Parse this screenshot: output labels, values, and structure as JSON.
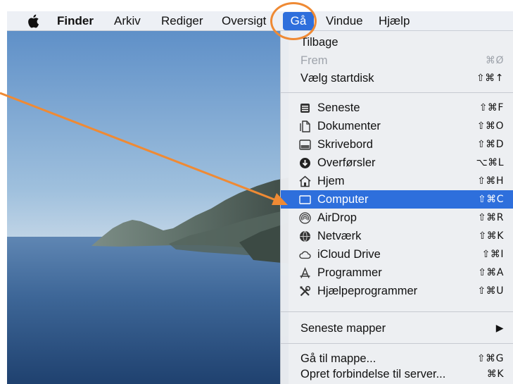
{
  "menubar": {
    "finder": "Finder",
    "arkiv": "Arkiv",
    "rediger": "Rediger",
    "oversigt": "Oversigt",
    "ga": "Gå",
    "vindue": "Vindue",
    "hjaelp": "Hjælp"
  },
  "menu": {
    "tilbage": {
      "label": "Tilbage"
    },
    "frem": {
      "label": "Frem",
      "shortcut": "⌘Ø"
    },
    "startdisk": {
      "label": "Vælg startdisk",
      "shortcut": "⇧⌘↑"
    },
    "seneste": {
      "label": "Seneste",
      "shortcut": "⇧⌘F",
      "icon": "recents-icon"
    },
    "dokumenter": {
      "label": "Dokumenter",
      "shortcut": "⇧⌘O",
      "icon": "documents-icon"
    },
    "skrivebord": {
      "label": "Skrivebord",
      "shortcut": "⇧⌘D",
      "icon": "desktop-icon"
    },
    "overforsler": {
      "label": "Overførsler",
      "shortcut": "⌥⌘L",
      "icon": "downloads-icon"
    },
    "hjem": {
      "label": "Hjem",
      "shortcut": "⇧⌘H",
      "icon": "home-icon"
    },
    "computer": {
      "label": "Computer",
      "shortcut": "⇧⌘C",
      "icon": "computer-icon"
    },
    "airdrop": {
      "label": "AirDrop",
      "shortcut": "⇧⌘R",
      "icon": "airdrop-icon"
    },
    "netvaerk": {
      "label": "Netværk",
      "shortcut": "⇧⌘K",
      "icon": "network-icon"
    },
    "icloud": {
      "label": "iCloud Drive",
      "shortcut": "⇧⌘I",
      "icon": "cloud-icon"
    },
    "programmer": {
      "label": "Programmer",
      "shortcut": "⇧⌘A",
      "icon": "applications-icon"
    },
    "hjaelpeprogrammer": {
      "label": "Hjælpeprogrammer",
      "shortcut": "⇧⌘U",
      "icon": "utilities-icon"
    },
    "seneste_mapper": {
      "label": "Seneste mapper",
      "shortcut": "▶"
    },
    "ga_til_mappe": {
      "label": "Gå til mappe...",
      "shortcut": "⇧⌘G"
    },
    "opret": {
      "label": "Opret forbindelse til server...",
      "shortcut": "⌘K"
    }
  },
  "colors": {
    "accent": "#2e6fdc",
    "annotation": "#ef8a34"
  }
}
